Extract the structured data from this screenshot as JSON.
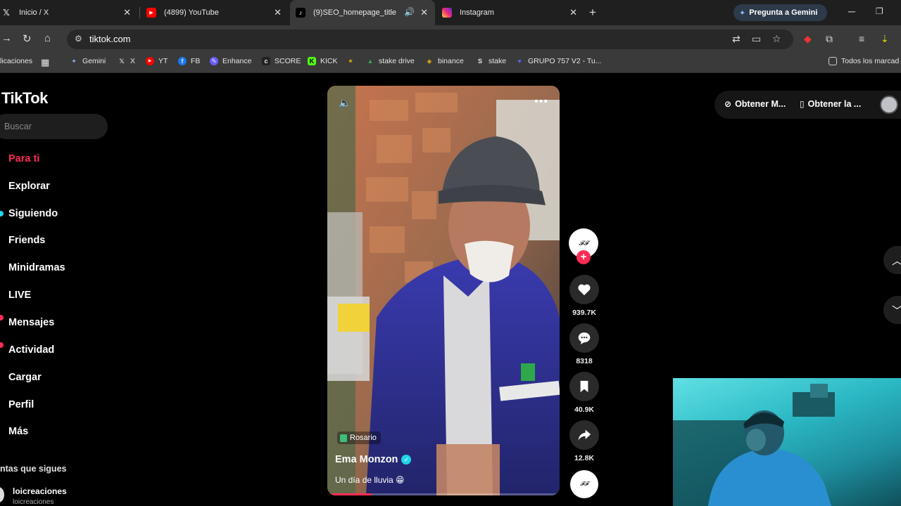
{
  "browser": {
    "tabs": [
      {
        "title": "Inicio / X",
        "icon": "x-logo-icon"
      },
      {
        "title": "(4899) YouTube",
        "icon": "youtube-icon"
      },
      {
        "title": "(9)SEO_homepage_title",
        "icon": "tiktok-icon",
        "active": true
      },
      {
        "title": "Instagram",
        "icon": "instagram-icon"
      }
    ],
    "gemini_button": "Pregunta a Gemini",
    "url": "tiktok.com",
    "bookmarks": [
      "licaciones",
      "Gemini",
      "X",
      "YT",
      "FB",
      "Enhance",
      "SCORE",
      "KICK",
      "stake drive",
      "binance",
      "stake",
      "GRUPO 757 V2 - Tu...",
      "Todos los marcad"
    ]
  },
  "tiktok": {
    "logo": "TikTok",
    "search_placeholder": "Buscar",
    "nav": [
      "Para ti",
      "Explorar",
      "Siguiendo",
      "Friends",
      "Minidramas",
      "LIVE",
      "Mensajes",
      "Actividad",
      "Cargar",
      "Perfil",
      "Más"
    ],
    "following_title": "ntas que sigues",
    "following_account": {
      "name": "loicreaciones",
      "handle": "loicreaciones"
    },
    "top_actions": [
      "Obtener M...",
      "Obtener la ..."
    ],
    "video": {
      "location": "Rosario",
      "author": "Ema Monzon",
      "caption": "Un día de lluvia 😁",
      "progress": 0.19
    },
    "actions": {
      "likes": "939.7K",
      "comments": "8318",
      "saves": "40.9K",
      "shares": "12.8K"
    }
  },
  "colors": {
    "accent": "#fe2c55",
    "chrome_bg": "#3a3a3a",
    "tab_bar_bg": "#1f1f1f"
  }
}
